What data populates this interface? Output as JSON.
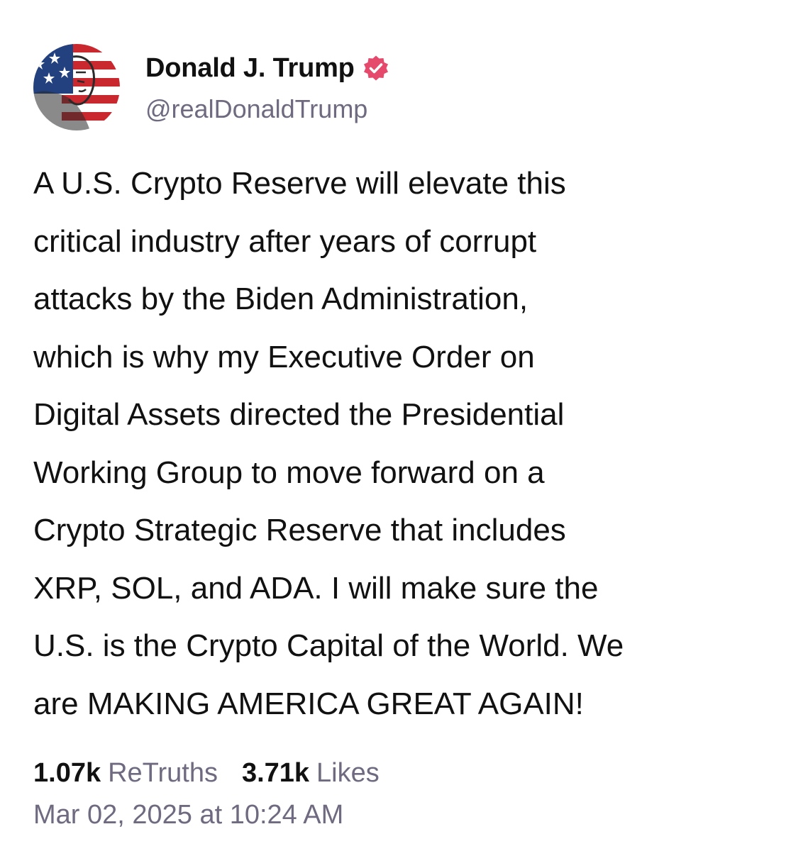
{
  "post": {
    "author": {
      "display_name": "Donald J. Trump",
      "handle": "@realDonaldTrump",
      "verified_icon": "verified-badge-icon",
      "verified_color": "#e5496b"
    },
    "lines": [
      "A U.S. Crypto Reserve will elevate this",
      "critical industry after years of corrupt",
      "attacks by the Biden Administration,",
      "which is why my Executive Order on",
      "Digital Assets directed the Presidential",
      "Working Group to move forward on a",
      "Crypto Strategic Reserve that includes",
      "XRP, SOL, and ADA. I will make sure the",
      "U.S. is the Crypto Capital of the World. We",
      "are MAKING AMERICA GREAT AGAIN!"
    ],
    "stats": {
      "retruths_count": "1.07k",
      "retruths_label": "ReTruths",
      "likes_count": "3.71k",
      "likes_label": "Likes"
    },
    "timestamp": "Mar 02, 2025 at 10:24 AM"
  }
}
